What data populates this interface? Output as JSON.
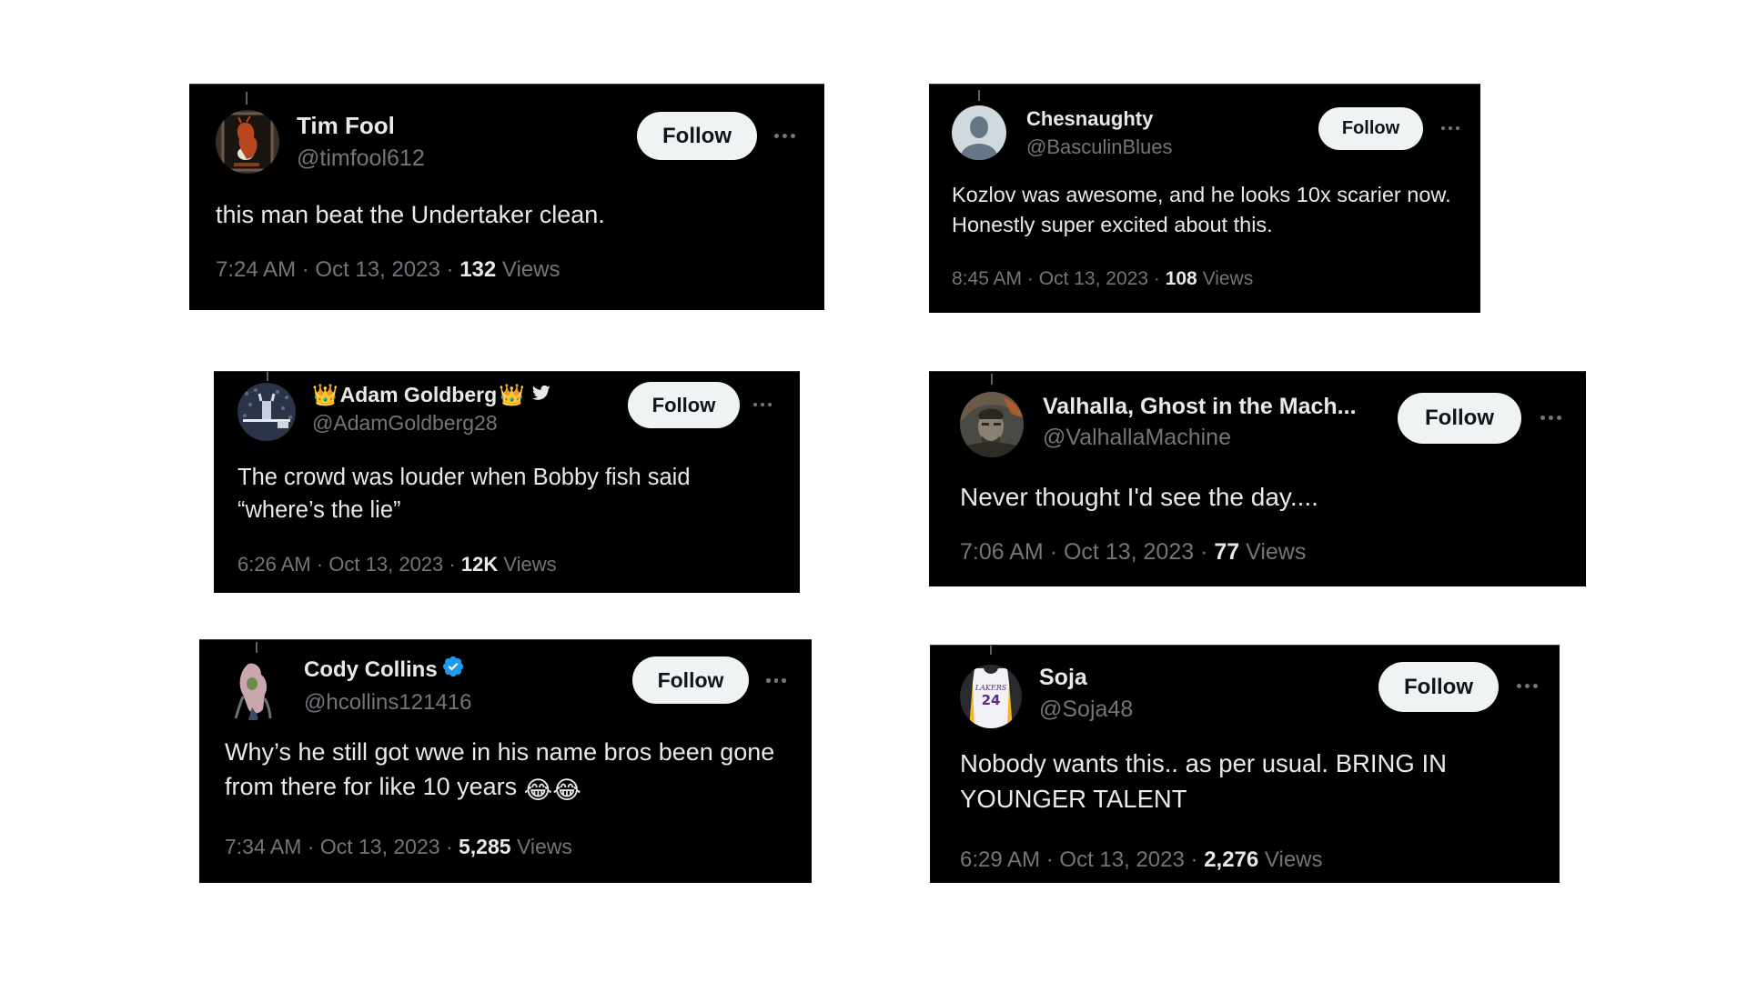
{
  "colors": {
    "card_bg": "#000000",
    "text_primary": "#e7e9ea",
    "text_secondary": "#71767b",
    "follow_bg": "#eff3f4",
    "follow_text": "#0f1419",
    "verified_blue": "#1d9bf0"
  },
  "tweets": [
    {
      "display_name": "Tim Fool",
      "handle": "@timfool612",
      "avatar": "devil-figure-avatar",
      "badges": [],
      "follow_label": "Follow",
      "more_icon": "ellipsis-icon",
      "text": "this man beat the Undertaker clean.",
      "time": "7:24 AM",
      "date": "Oct 13, 2023",
      "separator": "·",
      "views_count": "132",
      "views_label": "Views"
    },
    {
      "display_name": "Chesnaughty",
      "handle": "@BasculinBlues",
      "avatar": "default-user-avatar",
      "badges": [],
      "follow_label": "Follow",
      "more_icon": "ellipsis-icon",
      "text": "Kozlov was awesome, and he looks 10x scarier now. Honestly super excited about this.",
      "time": "8:45 AM",
      "date": "Oct 13, 2023",
      "separator": "·",
      "views_count": "108",
      "views_label": "Views"
    },
    {
      "display_name": "Adam Goldberg",
      "name_prefix_emoji": "👑",
      "name_suffix_emoji": "👑",
      "handle": "@AdamGoldberg28",
      "avatar": "crowd-photo-avatar",
      "badges": [
        "crown-emoji",
        "twitter-bird-icon"
      ],
      "follow_label": "Follow",
      "more_icon": "ellipsis-icon",
      "text": "The crowd was louder when Bobby fish said “where’s the lie”",
      "time": "6:26 AM",
      "date": "Oct 13, 2023",
      "separator": "·",
      "views_count": "12K",
      "views_label": "Views"
    },
    {
      "display_name": "Valhalla, Ghost in the Mach...",
      "handle": "@ValhallaMachine",
      "avatar": "portrait-avatar",
      "badges": [],
      "follow_label": "Follow",
      "more_icon": "ellipsis-icon",
      "text": "Never thought I'd see the day....",
      "time": "7:06 AM",
      "date": "Oct 13, 2023",
      "separator": "·",
      "views_count": "77",
      "views_label": "Views"
    },
    {
      "display_name": "Cody Collins",
      "handle": "@hcollins121416",
      "avatar": "wrestler-avatar",
      "badges": [
        "verified-badge-icon"
      ],
      "follow_label": "Follow",
      "more_icon": "ellipsis-icon",
      "text": "Why’s he still got wwe in his name bros been gone from there for like 10 years",
      "text_emojis": "😂😂",
      "time": "7:34 AM",
      "date": "Oct 13, 2023",
      "separator": "·",
      "views_count": "5,285",
      "views_label": "Views"
    },
    {
      "display_name": "Soja",
      "handle": "@Soja48",
      "avatar": "lakers-jersey-avatar",
      "avatar_jersey_text": "LAKERS",
      "avatar_jersey_number": "24",
      "badges": [],
      "follow_label": "Follow",
      "more_icon": "ellipsis-icon",
      "text": "Nobody wants this.. as per usual. BRING IN YOUNGER TALENT",
      "time": "6:29 AM",
      "date": "Oct 13, 2023",
      "separator": "·",
      "views_count": "2,276",
      "views_label": "Views"
    }
  ]
}
